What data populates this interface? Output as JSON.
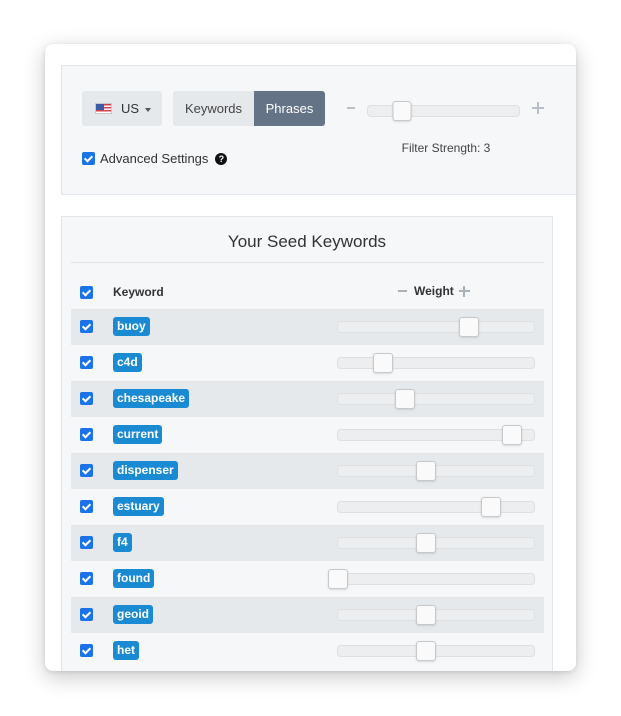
{
  "settings": {
    "country": {
      "label": "US",
      "flag_icon": "us-flag-icon"
    },
    "mode_tabs": [
      {
        "label": "Keywords",
        "selected": false
      },
      {
        "label": "Phrases",
        "selected": true
      }
    ],
    "filter": {
      "label": "Filter Strength: 3",
      "value": 3,
      "min": 1,
      "max": 10
    },
    "advanced": {
      "label": "Advanced Settings",
      "checked": true,
      "help_icon": "question-circle-icon"
    }
  },
  "seed": {
    "title": "Your Seed Keywords",
    "header": {
      "keyword_label": "Keyword",
      "weight_label": "Weight",
      "select_all_checked": true
    },
    "rows": [
      {
        "keyword": "buoy",
        "checked": true,
        "weight": 0.67
      },
      {
        "keyword": "c4d",
        "checked": true,
        "weight": 0.23
      },
      {
        "keyword": "chesapeake",
        "checked": true,
        "weight": 0.34
      },
      {
        "keyword": "current",
        "checked": true,
        "weight": 0.89
      },
      {
        "keyword": "dispenser",
        "checked": true,
        "weight": 0.45
      },
      {
        "keyword": "estuary",
        "checked": true,
        "weight": 0.78
      },
      {
        "keyword": "f4",
        "checked": true,
        "weight": 0.45
      },
      {
        "keyword": "found",
        "checked": true,
        "weight": 0.0
      },
      {
        "keyword": "geoid",
        "checked": true,
        "weight": 0.45
      },
      {
        "keyword": "het",
        "checked": true,
        "weight": 0.45
      }
    ]
  },
  "colors": {
    "accent": "#1a73e8",
    "tag": "#1a8ad3",
    "selected_tab": "#647386",
    "panel_bg": "#f5f7f9",
    "row_shade": "#e6e9ec"
  }
}
